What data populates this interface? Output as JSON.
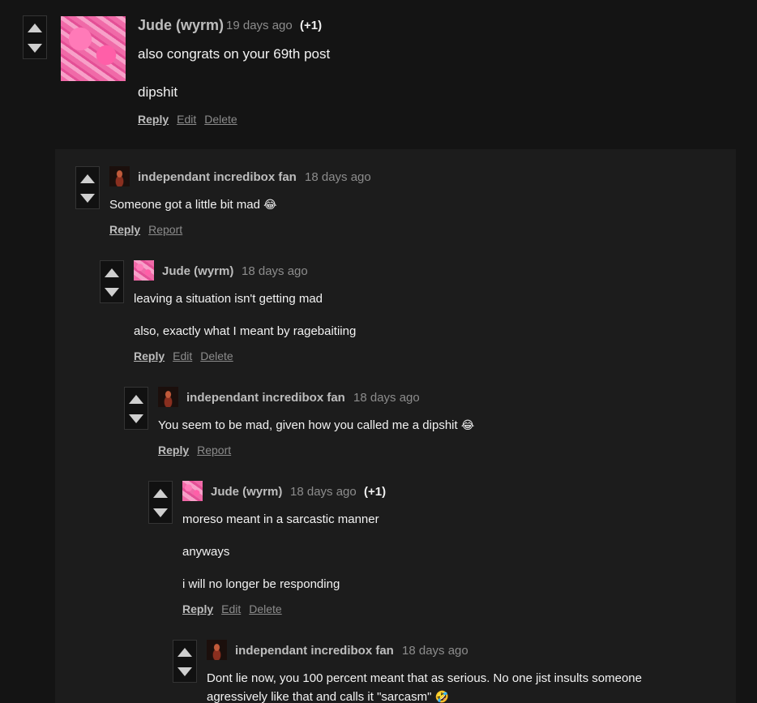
{
  "comments": [
    {
      "author": "Jude (wyrm)",
      "time": "19 days ago",
      "score": "(+1)",
      "lines": [
        "also congrats on your 69th post",
        "dipshit"
      ],
      "actions": [
        "Reply",
        "Edit",
        "Delete"
      ]
    },
    {
      "author": "independant incredibox fan",
      "time": "18 days ago",
      "lines": [
        "Someone got a little bit mad"
      ],
      "emoji": "😂",
      "actions": [
        "Reply",
        "Report"
      ]
    },
    {
      "author": "Jude (wyrm)",
      "time": "18 days ago",
      "lines": [
        "leaving a situation isn't getting mad",
        "also, exactly what I meant by ragebaitiing"
      ],
      "actions": [
        "Reply",
        "Edit",
        "Delete"
      ]
    },
    {
      "author": "independant incredibox fan",
      "time": "18 days ago",
      "lines": [
        "You seem to be mad, given how you called me a dipshit"
      ],
      "emoji": "😂",
      "actions": [
        "Reply",
        "Report"
      ]
    },
    {
      "author": "Jude (wyrm)",
      "time": "18 days ago",
      "score": "(+1)",
      "lines": [
        "moreso meant in a sarcastic manner",
        "anyways",
        "i will no longer be responding"
      ],
      "actions": [
        "Reply",
        "Edit",
        "Delete"
      ]
    },
    {
      "author": "independant incredibox fan",
      "time": "18 days ago",
      "lines": [
        "Dont lie now, you 100 percent meant that as serious. No one jist insults someone",
        "agressively like that and calls it \"sarcasm\""
      ],
      "emoji": "🤣"
    }
  ],
  "icons": {
    "upvote": "upvote-arrow-icon",
    "downvote": "downvote-arrow-icon"
  },
  "colors": {
    "background": "#141414",
    "nested_panel": "#1c1c1c",
    "author": "#bdbdbd",
    "timestamp": "#8c8c8c",
    "avatar_pink": "#f06aa8"
  }
}
